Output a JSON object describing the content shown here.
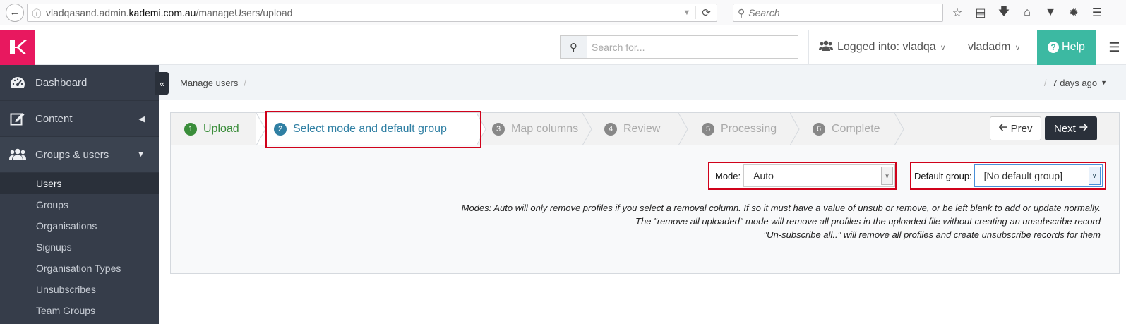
{
  "browser": {
    "url_prefix": "vladqasand.admin.",
    "url_domain": "kademi.com.au",
    "url_path": "/manageUsers/upload",
    "search_placeholder": "Search"
  },
  "header": {
    "search_placeholder": "Search for...",
    "logged_into_label": "Logged into: vladqa",
    "user_label": "vladadm",
    "help_label": "Help"
  },
  "sidebar": {
    "items": [
      {
        "label": "Dashboard"
      },
      {
        "label": "Content"
      },
      {
        "label": "Groups & users"
      }
    ],
    "sub_items": [
      {
        "label": "Users"
      },
      {
        "label": "Groups"
      },
      {
        "label": "Organisations"
      },
      {
        "label": "Signups"
      },
      {
        "label": "Organisation Types"
      },
      {
        "label": "Unsubscribes"
      },
      {
        "label": "Team Groups"
      }
    ]
  },
  "breadcrumb": {
    "item": "Manage users",
    "separator": "/",
    "time_ago": "7 days ago"
  },
  "wizard": {
    "steps": [
      {
        "num": "1",
        "label": "Upload"
      },
      {
        "num": "2",
        "label": "Select mode and default group"
      },
      {
        "num": "3",
        "label": "Map columns"
      },
      {
        "num": "4",
        "label": "Review"
      },
      {
        "num": "5",
        "label": "Processing"
      },
      {
        "num": "6",
        "label": "Complete"
      }
    ],
    "prev_label": "Prev",
    "next_label": "Next"
  },
  "form": {
    "mode_label": "Mode:",
    "mode_value": "Auto",
    "group_label": "Default group:",
    "group_value": "[No default group]"
  },
  "help_text": [
    "Modes: Auto will only remove profiles if you select a removal column. If so it must have a value of unsub or remove, or be left blank to add or update normally.",
    "The \"remove all uploaded\" mode will remove all profiles in the uploaded file without creating an unsubscribe record",
    "\"Un-subscribe all..\" will remove all profiles and create unsubscribe records for them"
  ],
  "colors": {
    "brand": "#e8185f",
    "help": "#3cb9a2",
    "sidebar": "#363d4a",
    "highlight": "#d0021b",
    "step_done": "#3a8d3a",
    "step_current": "#2f7fa3"
  }
}
